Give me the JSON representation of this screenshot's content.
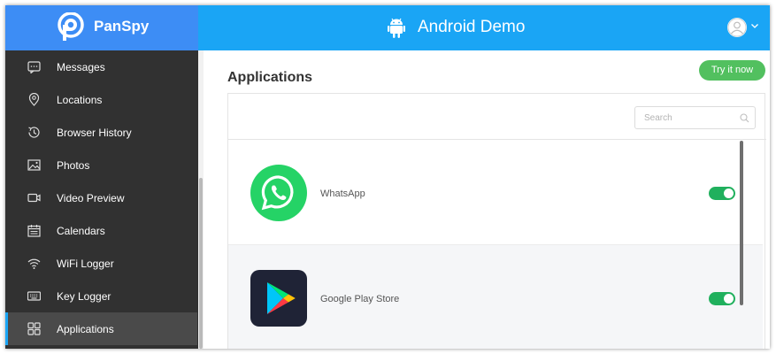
{
  "brand": {
    "name": "PanSpy"
  },
  "header": {
    "title": "Android Demo"
  },
  "sidebar": {
    "items": [
      {
        "label": "Messages",
        "icon": "message-icon"
      },
      {
        "label": "Locations",
        "icon": "location-pin-icon"
      },
      {
        "label": "Browser History",
        "icon": "clock-icon"
      },
      {
        "label": "Photos",
        "icon": "photo-icon"
      },
      {
        "label": "Video Preview",
        "icon": "video-camera-icon"
      },
      {
        "label": "Calendars",
        "icon": "calendar-icon"
      },
      {
        "label": "WiFi Logger",
        "icon": "wifi-icon"
      },
      {
        "label": "Key Logger",
        "icon": "keyboard-icon"
      },
      {
        "label": "Applications",
        "icon": "grid-icon",
        "active": true
      }
    ]
  },
  "main": {
    "title": "Applications",
    "try_button": "Try it now",
    "search": {
      "placeholder": "Search"
    },
    "apps": [
      {
        "name": "WhatsApp",
        "icon": "whatsapp-icon",
        "enabled": true
      },
      {
        "name": "Google Play Store",
        "icon": "google-play-icon",
        "enabled": true
      }
    ]
  },
  "colors": {
    "brand": "#3d8df5",
    "topbar": "#1aa5f5",
    "sidebar": "#313131",
    "try_button": "#52c05f",
    "toggle_on": "#20b05d"
  }
}
